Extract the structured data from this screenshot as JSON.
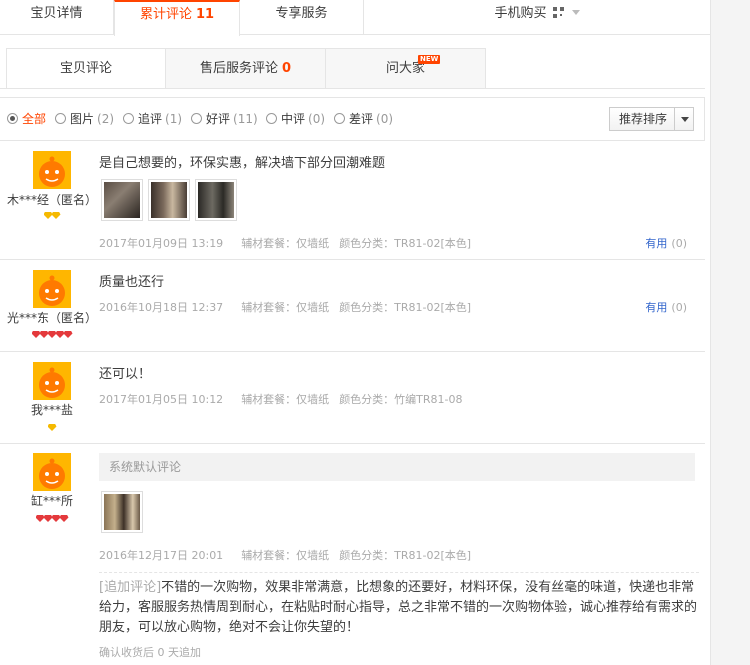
{
  "top_tabs": {
    "detail": "宝贝详情",
    "reviews": "累计评论",
    "reviews_count": "11",
    "service": "专享服务",
    "mobile": "手机购买"
  },
  "sub_tabs": {
    "reviews": "宝贝评论",
    "after_sales": "售后服务评论",
    "after_sales_count": "0",
    "ask": "问大家",
    "new_badge": "NEW"
  },
  "filters": [
    {
      "label": "全部",
      "count": ""
    },
    {
      "label": "图片",
      "count": "(2)"
    },
    {
      "label": "追评",
      "count": "(1)"
    },
    {
      "label": "好评",
      "count": "(11)"
    },
    {
      "label": "中评",
      "count": "(0)"
    },
    {
      "label": "差评",
      "count": "(0)"
    }
  ],
  "sort_label": "推荐排序",
  "reviews": [
    {
      "user": "木***经（匿名）",
      "badge_color": "gold",
      "badge_count": 2,
      "text": "是自己想要的，环保实惠，解决墙下部分回潮难题",
      "date": "2017年01月09日 13:19",
      "accessory": "辅材套餐：仅墙纸",
      "color": "颜色分类：TR81-02[本色]",
      "helpful_label": "有用",
      "helpful_count": "(0)"
    },
    {
      "user": "光***东（匿名）",
      "badge_color": "red",
      "badge_count": 5,
      "text": "质量也还行",
      "date": "2016年10月18日 12:37",
      "accessory": "辅材套餐：仅墙纸",
      "color": "颜色分类：TR81-02[本色]",
      "helpful_label": "有用",
      "helpful_count": "(0)"
    },
    {
      "user": "我***盐",
      "badge_color": "gold",
      "badge_count": 1,
      "text": "还可以！",
      "date": "2017年01月05日 10:12",
      "accessory": "辅材套餐：仅墙纸",
      "color": "颜色分类：竹编TR81-08"
    },
    {
      "user": "缸***所",
      "badge_color": "red",
      "badge_count": 4,
      "text": "系统默认评论",
      "date": "2016年12月17日 20:01",
      "accessory": "辅材套餐：仅墙纸",
      "color": "颜色分类：TR81-02[本色]",
      "append_tag": "[追加评论]",
      "append_text": "不错的一次购物，效果非常满意，比想象的还要好，材料环保，没有丝毫的味道，快递也非常给力，客服服务热情周到耐心，在粘贴时耐心指导，总之非常不错的一次购物体验，诚心推荐给有需求的朋友，可以放心购物，绝对不会让你失望的！",
      "append_after": "确认收货后 0 天追加"
    }
  ]
}
